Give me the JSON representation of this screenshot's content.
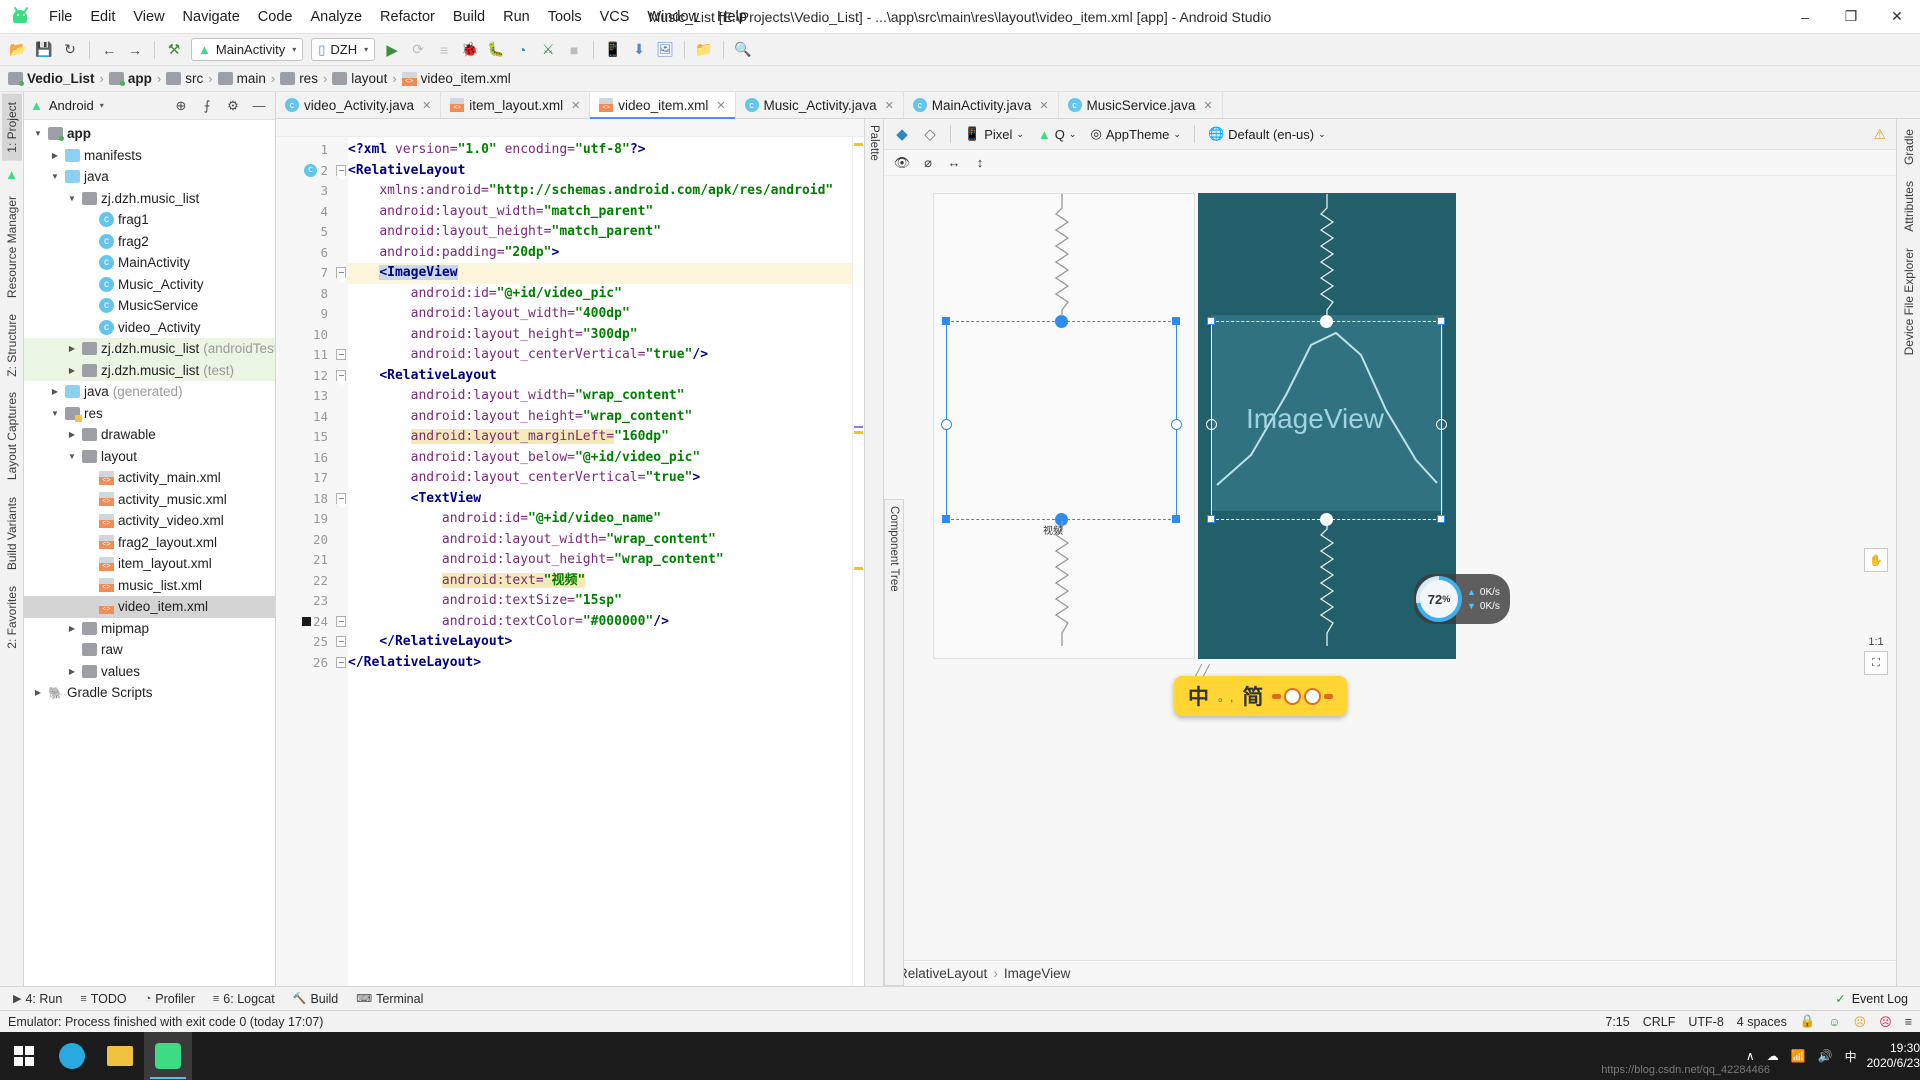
{
  "window": {
    "title": "Music_List [E:\\Projects\\Vedio_List] - ...\\app\\src\\main\\res\\layout\\video_item.xml [app] - Android Studio",
    "minimize": "–",
    "maximize": "❐",
    "close": "✕"
  },
  "menu": [
    {
      "label": "File"
    },
    {
      "label": "Edit"
    },
    {
      "label": "View"
    },
    {
      "label": "Navigate"
    },
    {
      "label": "Code"
    },
    {
      "label": "Analyze"
    },
    {
      "label": "Refactor"
    },
    {
      "label": "Build"
    },
    {
      "label": "Run"
    },
    {
      "label": "Tools"
    },
    {
      "label": "VCS"
    },
    {
      "label": "Window"
    },
    {
      "label": "Help"
    }
  ],
  "toolbar": {
    "open_icon": "📂",
    "save_icon": "💾",
    "sync_icon": "↻",
    "back_icon": "←",
    "forward_icon": "→",
    "build_icon": "⚒",
    "run_config": "MainActivity",
    "device": "DZH",
    "run_icon": "▶",
    "apply_changes_icon": "⟳",
    "apply_code_icon": "≡",
    "debug_icon": "🐞",
    "attach_icon": "🐛",
    "profiler_icon": "◔",
    "stop_icon": "■",
    "avd_icon": "📱",
    "sdk_icon": "⬇",
    "layout_inspector_icon": "🖼",
    "device_file_icon": "📁",
    "search_icon": "🔍",
    "caret": "▾"
  },
  "breadcrumb": [
    {
      "label": "Vedio_List",
      "bold": true
    },
    {
      "label": "app",
      "bold": true
    },
    {
      "label": "src",
      "bold": false
    },
    {
      "label": "main",
      "bold": false
    },
    {
      "label": "res",
      "bold": false
    },
    {
      "label": "layout",
      "bold": false
    },
    {
      "label": "video_item.xml",
      "bold": false
    }
  ],
  "left_rail": [
    "1: Project",
    "Resource Manager",
    "Z: Structure",
    "Layout Captures",
    "Build Variants",
    "2: Favorites"
  ],
  "right_rail": [
    "Gradle",
    "Attributes",
    "Device File Explorer"
  ],
  "project": {
    "selector": "Android",
    "selector_caret": "▾",
    "locate_icon": "⊕",
    "collapse_icon": "⨍",
    "settings_icon": "⚙",
    "hide_icon": "—",
    "tree": [
      {
        "indent": 0,
        "arrow": "▼",
        "icon": "folder-grey-dot",
        "label": "app",
        "bold": true,
        "dim": "",
        "state": ""
      },
      {
        "indent": 1,
        "arrow": "▶",
        "icon": "folder-blue",
        "label": "manifests",
        "bold": false,
        "dim": "",
        "state": ""
      },
      {
        "indent": 1,
        "arrow": "▼",
        "icon": "folder-blue",
        "label": "java",
        "bold": false,
        "dim": "",
        "state": ""
      },
      {
        "indent": 2,
        "arrow": "▼",
        "icon": "package",
        "label": "zj.dzh.music_list",
        "bold": false,
        "dim": "",
        "state": ""
      },
      {
        "indent": 3,
        "arrow": "",
        "icon": "class",
        "label": "frag1",
        "bold": false,
        "dim": "",
        "state": ""
      },
      {
        "indent": 3,
        "arrow": "",
        "icon": "class",
        "label": "frag2",
        "bold": false,
        "dim": "",
        "state": ""
      },
      {
        "indent": 3,
        "arrow": "",
        "icon": "class",
        "label": "MainActivity",
        "bold": false,
        "dim": "",
        "state": ""
      },
      {
        "indent": 3,
        "arrow": "",
        "icon": "class",
        "label": "Music_Activity",
        "bold": false,
        "dim": "",
        "state": ""
      },
      {
        "indent": 3,
        "arrow": "",
        "icon": "class",
        "label": "MusicService",
        "bold": false,
        "dim": "",
        "state": ""
      },
      {
        "indent": 3,
        "arrow": "",
        "icon": "class",
        "label": "video_Activity",
        "bold": false,
        "dim": "",
        "state": ""
      },
      {
        "indent": 2,
        "arrow": "▶",
        "icon": "package",
        "label": "zj.dzh.music_list",
        "bold": false,
        "dim": "(androidTest)",
        "state": "test"
      },
      {
        "indent": 2,
        "arrow": "▶",
        "icon": "package",
        "label": "zj.dzh.music_list",
        "bold": false,
        "dim": "(test)",
        "state": "test"
      },
      {
        "indent": 1,
        "arrow": "▶",
        "icon": "folder-gen",
        "label": "java",
        "bold": false,
        "dim": "(generated)",
        "state": ""
      },
      {
        "indent": 1,
        "arrow": "▼",
        "icon": "folder-res",
        "label": "res",
        "bold": false,
        "dim": "",
        "state": ""
      },
      {
        "indent": 2,
        "arrow": "▶",
        "icon": "package",
        "label": "drawable",
        "bold": false,
        "dim": "",
        "state": ""
      },
      {
        "indent": 2,
        "arrow": "▼",
        "icon": "package",
        "label": "layout",
        "bold": false,
        "dim": "",
        "state": ""
      },
      {
        "indent": 3,
        "arrow": "",
        "icon": "xml",
        "label": "activity_main.xml",
        "bold": false,
        "dim": "",
        "state": ""
      },
      {
        "indent": 3,
        "arrow": "",
        "icon": "xml",
        "label": "activity_music.xml",
        "bold": false,
        "dim": "",
        "state": ""
      },
      {
        "indent": 3,
        "arrow": "",
        "icon": "xml",
        "label": "activity_video.xml",
        "bold": false,
        "dim": "",
        "state": ""
      },
      {
        "indent": 3,
        "arrow": "",
        "icon": "xml",
        "label": "frag2_layout.xml",
        "bold": false,
        "dim": "",
        "state": ""
      },
      {
        "indent": 3,
        "arrow": "",
        "icon": "xml",
        "label": "item_layout.xml",
        "bold": false,
        "dim": "",
        "state": ""
      },
      {
        "indent": 3,
        "arrow": "",
        "icon": "xml",
        "label": "music_list.xml",
        "bold": false,
        "dim": "",
        "state": ""
      },
      {
        "indent": 3,
        "arrow": "",
        "icon": "xml",
        "label": "video_item.xml",
        "bold": false,
        "dim": "",
        "state": "sel"
      },
      {
        "indent": 2,
        "arrow": "▶",
        "icon": "package",
        "label": "mipmap",
        "bold": false,
        "dim": "",
        "state": ""
      },
      {
        "indent": 2,
        "arrow": "",
        "icon": "package",
        "label": "raw",
        "bold": false,
        "dim": "",
        "state": ""
      },
      {
        "indent": 2,
        "arrow": "▶",
        "icon": "package",
        "label": "values",
        "bold": false,
        "dim": "",
        "state": ""
      },
      {
        "indent": 0,
        "arrow": "▶",
        "icon": "gradle",
        "label": "Gradle Scripts",
        "bold": false,
        "dim": "",
        "state": ""
      }
    ]
  },
  "tabs": [
    {
      "label": "video_Activity.java",
      "type": "java",
      "active": false
    },
    {
      "label": "item_layout.xml",
      "type": "xml",
      "active": false
    },
    {
      "label": "video_item.xml",
      "type": "xml",
      "active": true
    },
    {
      "label": "Music_Activity.java",
      "type": "java",
      "active": false
    },
    {
      "label": "MainActivity.java",
      "type": "java",
      "active": false
    },
    {
      "label": "MusicService.java",
      "type": "java",
      "active": false
    }
  ],
  "code": {
    "lines": [
      {
        "n": 1,
        "indent": 0,
        "hl": false,
        "gutter": "",
        "fold": "",
        "segs": [
          {
            "t": "pi",
            "v": "<?xml "
          },
          {
            "t": "attr",
            "v": "version="
          },
          {
            "t": "val",
            "v": "\"1.0\""
          },
          {
            "t": "plain",
            "v": " "
          },
          {
            "t": "attr",
            "v": "encoding="
          },
          {
            "t": "val",
            "v": "\"utf-8\""
          },
          {
            "t": "pi",
            "v": "?>"
          }
        ]
      },
      {
        "n": 2,
        "indent": 0,
        "hl": false,
        "gutter": "c",
        "fold": "pt",
        "segs": [
          {
            "t": "tag",
            "v": "<RelativeLayout"
          }
        ]
      },
      {
        "n": 3,
        "indent": 1,
        "hl": false,
        "gutter": "",
        "fold": "",
        "segs": [
          {
            "t": "attr",
            "v": "xmlns:android="
          },
          {
            "t": "val",
            "v": "\"http://schemas.android.com/apk/res/android\""
          }
        ]
      },
      {
        "n": 4,
        "indent": 1,
        "hl": false,
        "gutter": "",
        "fold": "",
        "segs": [
          {
            "t": "attr",
            "v": "android:layout_width="
          },
          {
            "t": "val",
            "v": "\"match_parent\""
          }
        ]
      },
      {
        "n": 5,
        "indent": 1,
        "hl": false,
        "gutter": "",
        "fold": "",
        "segs": [
          {
            "t": "attr",
            "v": "android:layout_height="
          },
          {
            "t": "val",
            "v": "\"match_parent\""
          }
        ]
      },
      {
        "n": 6,
        "indent": 1,
        "hl": false,
        "gutter": "",
        "fold": "",
        "segs": [
          {
            "t": "attr",
            "v": "android:padding="
          },
          {
            "t": "val",
            "v": "\"20dp\""
          },
          {
            "t": "tag",
            "v": ">"
          }
        ]
      },
      {
        "n": 7,
        "indent": 1,
        "hl": true,
        "gutter": "",
        "fold": "pt",
        "segs": [
          {
            "t": "sel",
            "v": "<ImageView"
          }
        ]
      },
      {
        "n": 8,
        "indent": 2,
        "hl": false,
        "gutter": "",
        "fold": "",
        "segs": [
          {
            "t": "attr",
            "v": "android:id="
          },
          {
            "t": "val",
            "v": "\"@+id/video_pic\""
          }
        ]
      },
      {
        "n": 9,
        "indent": 2,
        "hl": false,
        "gutter": "",
        "fold": "",
        "segs": [
          {
            "t": "attr",
            "v": "android:layout_width="
          },
          {
            "t": "val",
            "v": "\"400dp\""
          }
        ]
      },
      {
        "n": 10,
        "indent": 2,
        "hl": false,
        "gutter": "",
        "fold": "",
        "segs": [
          {
            "t": "attr",
            "v": "android:layout_height="
          },
          {
            "t": "val",
            "v": "\"300dp\""
          }
        ]
      },
      {
        "n": 11,
        "indent": 2,
        "hl": false,
        "gutter": "",
        "fold": "pb",
        "segs": [
          {
            "t": "attr",
            "v": "android:layout_centerVertical="
          },
          {
            "t": "val",
            "v": "\"true\""
          },
          {
            "t": "tag",
            "v": "/>"
          }
        ]
      },
      {
        "n": 12,
        "indent": 1,
        "hl": false,
        "gutter": "",
        "fold": "pt",
        "segs": [
          {
            "t": "tag",
            "v": "<RelativeLayout"
          }
        ]
      },
      {
        "n": 13,
        "indent": 2,
        "hl": false,
        "gutter": "",
        "fold": "",
        "segs": [
          {
            "t": "attr",
            "v": "android:layout_width="
          },
          {
            "t": "val",
            "v": "\"wrap_content\""
          }
        ]
      },
      {
        "n": 14,
        "indent": 2,
        "hl": false,
        "gutter": "",
        "fold": "",
        "segs": [
          {
            "t": "attr",
            "v": "android:layout_height="
          },
          {
            "t": "val",
            "v": "\"wrap_content\""
          }
        ]
      },
      {
        "n": 15,
        "indent": 2,
        "hl": false,
        "gutter": "",
        "fold": "",
        "segs": [
          {
            "t": "warnattr",
            "v": "android:layout_marginLeft="
          },
          {
            "t": "val",
            "v": "\"160dp\""
          }
        ]
      },
      {
        "n": 16,
        "indent": 2,
        "hl": false,
        "gutter": "",
        "fold": "",
        "segs": [
          {
            "t": "attr",
            "v": "android:layout_below="
          },
          {
            "t": "val",
            "v": "\"@+id/video_pic\""
          }
        ]
      },
      {
        "n": 17,
        "indent": 2,
        "hl": false,
        "gutter": "",
        "fold": "",
        "segs": [
          {
            "t": "attr",
            "v": "android:layout_centerVertical="
          },
          {
            "t": "val",
            "v": "\"true\""
          },
          {
            "t": "tag",
            "v": ">"
          }
        ]
      },
      {
        "n": 18,
        "indent": 2,
        "hl": false,
        "gutter": "",
        "fold": "pt",
        "segs": [
          {
            "t": "tag",
            "v": "<TextView"
          }
        ]
      },
      {
        "n": 19,
        "indent": 3,
        "hl": false,
        "gutter": "",
        "fold": "",
        "segs": [
          {
            "t": "attr",
            "v": "android:id="
          },
          {
            "t": "val",
            "v": "\"@+id/video_name\""
          }
        ]
      },
      {
        "n": 20,
        "indent": 3,
        "hl": false,
        "gutter": "",
        "fold": "",
        "segs": [
          {
            "t": "attr",
            "v": "android:layout_width="
          },
          {
            "t": "val",
            "v": "\"wrap_content\""
          }
        ]
      },
      {
        "n": 21,
        "indent": 3,
        "hl": false,
        "gutter": "",
        "fold": "",
        "segs": [
          {
            "t": "attr",
            "v": "android:layout_height="
          },
          {
            "t": "val",
            "v": "\"wrap_content\""
          }
        ]
      },
      {
        "n": 22,
        "indent": 3,
        "hl": false,
        "gutter": "",
        "fold": "",
        "segs": [
          {
            "t": "warnattr",
            "v": "android:text="
          },
          {
            "t": "warnval",
            "v": "\"视频\""
          }
        ]
      },
      {
        "n": 23,
        "indent": 3,
        "hl": false,
        "gutter": "",
        "fold": "",
        "segs": [
          {
            "t": "attr",
            "v": "android:textSize="
          },
          {
            "t": "val",
            "v": "\"15sp\""
          }
        ]
      },
      {
        "n": 24,
        "indent": 3,
        "hl": false,
        "gutter": "bp",
        "fold": "pb",
        "segs": [
          {
            "t": "attr",
            "v": "android:textColor="
          },
          {
            "t": "val",
            "v": "\"#000000\""
          },
          {
            "t": "tag",
            "v": "/>"
          }
        ]
      },
      {
        "n": 25,
        "indent": 1,
        "hl": false,
        "gutter": "",
        "fold": "pb",
        "segs": [
          {
            "t": "tag",
            "v": "</RelativeLayout>"
          }
        ]
      },
      {
        "n": 26,
        "indent": 0,
        "hl": false,
        "gutter": "",
        "fold": "pb",
        "segs": [
          {
            "t": "tag",
            "v": "</RelativeLayout>"
          }
        ]
      }
    ]
  },
  "palette_strip": "Palette",
  "component_tree_strip": "Component Tree",
  "design": {
    "toolbar": {
      "layers_icon": "◆",
      "blueprint_icon": "◇",
      "device_icon": "📱",
      "device_label": "Pixel",
      "api_icon": "🤖",
      "api_label": "Q",
      "theme_icon": "◎",
      "theme_label": "AppTheme",
      "locale_icon": "🌐",
      "locale_label": "Default (en-us)",
      "caret": "⌄",
      "warning_icon": "⚠",
      "panel_icon": "≡"
    },
    "toolbar2": {
      "eye_icon": "👁",
      "noeye_icon": "⌀",
      "width_icon": "↔",
      "height_icon": "↕"
    },
    "imageview_label": "ImageView",
    "textview_label": "视频",
    "zoom_ratio": "1:1",
    "pan_icon": "✋",
    "fit_icon": "⛶"
  },
  "component_path": {
    "parent": "RelativeLayout",
    "sep": "›",
    "child": "ImageView"
  },
  "bottom_tools": [
    {
      "icon": "▶",
      "label": "4: Run"
    },
    {
      "icon": "≡",
      "label": "TODO"
    },
    {
      "icon": "◔",
      "label": "Profiler"
    },
    {
      "icon": "≡",
      "label": "6: Logcat"
    },
    {
      "icon": "🔨",
      "label": "Build"
    },
    {
      "icon": "⌨",
      "label": "Terminal"
    }
  ],
  "bottom_right": {
    "event_icon": "✓",
    "event_label": "Event Log"
  },
  "status": {
    "message": "Emulator: Process finished with exit code 0 (today 17:07)",
    "caret_pos": "7:15",
    "line_sep": "CRLF",
    "encoding": "UTF-8",
    "indent": "4 spaces",
    "lock_icon": "🔒",
    "face1": "☺",
    "face2": "☹",
    "face3": "☹",
    "bar_icon": "≡"
  },
  "network_widget": {
    "percent": "72",
    "percent_sign": "%",
    "up_rate": "0K/s",
    "down_rate": "0K/s",
    "up_arrow": "▲",
    "down_arrow": "▼"
  },
  "ime_bar": {
    "mode": "中",
    "punct": "。,",
    "style": "简"
  },
  "taskbar": {
    "start_icon": "windows-logo",
    "apps": [
      {
        "name": "cortana-icon",
        "glyph": "○"
      },
      {
        "name": "file-explorer-icon",
        "glyph": "📁"
      },
      {
        "name": "android-studio-icon",
        "glyph": "🤖"
      }
    ],
    "tray": [
      "∧",
      "☁",
      "📶",
      "🔊",
      "中"
    ],
    "time": "19:30",
    "date": "2020/6/23",
    "watermark": "https://blog.csdn.net/qq_42284466",
    "watermark2": "2020/6/23"
  }
}
